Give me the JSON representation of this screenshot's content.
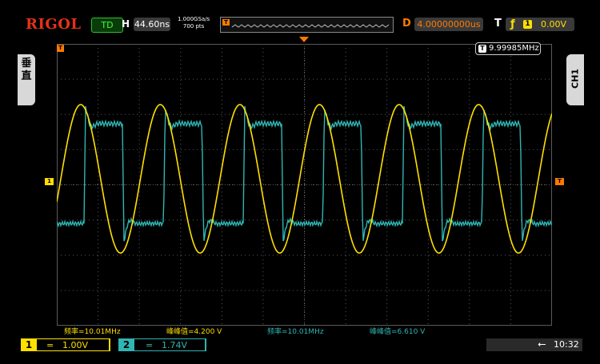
{
  "brand": "RIGOL",
  "run_state": "TD",
  "horizontal": {
    "label": "H",
    "timebase": "44.60ns"
  },
  "acquisition": {
    "sample_rate": "1.000GSa/s",
    "points": "700 pts"
  },
  "delay": {
    "label": "D",
    "value": "4.00000000us"
  },
  "trigger": {
    "label": "T",
    "edge_symbol": "ƒ",
    "source": "1",
    "level": "0.00V",
    "marker_label": "T"
  },
  "side_tabs": {
    "left_label": "垂\n直",
    "right_label": "CH1"
  },
  "frequency_counter": {
    "badge": "T",
    "value": "9.99985MHz"
  },
  "channel_markers": {
    "ch1": "1"
  },
  "measurements": [
    {
      "text": "频率=10.01MHz",
      "color": "#ffdf00"
    },
    {
      "text": "峰峰值=4.200 V",
      "color": "#ffdf00"
    },
    {
      "text": "频率=10.01MHz",
      "color": "#2fb5b3"
    },
    {
      "text": "峰峰值=6.610 V",
      "color": "#2fb5b3"
    }
  ],
  "channels": [
    {
      "number": "1",
      "coupling": "=",
      "scale": "1.00V",
      "color": "#ffdf00"
    },
    {
      "number": "2",
      "coupling": "=",
      "scale": "1.74V",
      "color": "#2fb5b3"
    }
  ],
  "status": {
    "usb_icon": "usb-icon",
    "time": "10:32"
  },
  "colors": {
    "ch1": "#ffdf00",
    "ch2": "#2fb5b3",
    "accent": "#ff7a00",
    "logo": "#e63219",
    "grid": "#5a5a5a"
  }
}
